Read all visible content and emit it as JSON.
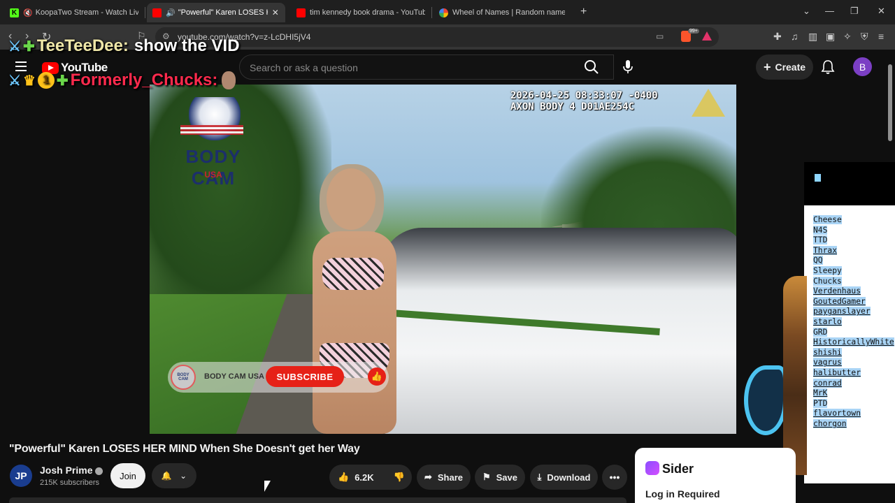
{
  "browser": {
    "tabs": [
      {
        "label": "KoopaTwo Stream - Watch Live o",
        "favicon_color": "#53fc18",
        "favicon_letter": "K"
      },
      {
        "label": "\"Powerful\" Karen LOSES HER I",
        "favicon_color": "#ff0000",
        "active": true
      },
      {
        "label": "tim kennedy book drama - YouTube",
        "favicon_color": "#ff0000"
      },
      {
        "label": "Wheel of Names | Random name pic",
        "favicon_color": "#4285f4"
      }
    ],
    "close_symbol": "✕",
    "new_tab_symbol": "+",
    "url": "youtube.com/watch?v=z-LcDHI5jV4",
    "extension_badge": "99+"
  },
  "youtube": {
    "logo_text": "YouTube",
    "search_placeholder": "Search or ask a question",
    "create_label": "Create",
    "account_initial": "B",
    "video": {
      "osd_timestamp": "2026-04-25 08:33:07 -0400",
      "osd_device": "AXON BODY 4 D01AE254C",
      "watermark_text": "BODY CAM",
      "watermark_sub": "USA",
      "overlay_badge": "BODY CAM",
      "overlay_channel": "BODY CAM USA",
      "overlay_subscribe": "SUBSCRIBE"
    },
    "title": "\"Powerful\" Karen LOSES HER MIND When She Doesn't get her Way",
    "channel": {
      "initials": "JP",
      "name": "Josh Prime",
      "subscribers": "215K subscribers"
    },
    "actions": {
      "join": "Join",
      "likes": "6.2K",
      "share": "Share",
      "save": "Save",
      "download": "Download",
      "more": "•••"
    }
  },
  "stream_chat": [
    {
      "user": "TeeTeeDee:",
      "message": "show the VID",
      "user_color": "#efe7a8"
    },
    {
      "user": "Formerly_Chucks:",
      "message": "",
      "user_color": "#ff2a4d",
      "badge_number": "1"
    }
  ],
  "name_list": [
    {
      "name": "Cheese",
      "underlined": false
    },
    {
      "name": "N4S",
      "underlined": false
    },
    {
      "name": "TTD",
      "underlined": false
    },
    {
      "name": "Thrax",
      "underlined": true
    },
    {
      "name": "QQ",
      "underlined": false
    },
    {
      "name": "Sleepy",
      "underlined": false
    },
    {
      "name": "Chucks",
      "underlined": false
    },
    {
      "name": "Verdenhaus",
      "underlined": true
    },
    {
      "name": "GoutedGamer",
      "underlined": true
    },
    {
      "name": "payganslayer",
      "underlined": true
    },
    {
      "name": "starlo",
      "underlined": true
    },
    {
      "name": "GRD",
      "underlined": false
    },
    {
      "name": "HistoricallyWhite",
      "underlined": true
    },
    {
      "name": "shishi",
      "underlined": true
    },
    {
      "name": "vagrus",
      "underlined": true
    },
    {
      "name": "halibutter",
      "underlined": true
    },
    {
      "name": "conrad",
      "underlined": true
    },
    {
      "name": "MrK",
      "underlined": true
    },
    {
      "name": "PTD",
      "underlined": false
    },
    {
      "name": "flavortown",
      "underlined": true
    },
    {
      "name": "chorgon",
      "underlined": true
    }
  ],
  "sider": {
    "title": "Sider",
    "status": "Log in Required"
  },
  "colors": {
    "youtube_red": "#ff0000",
    "background": "#0f0f0f",
    "pill": "#272727",
    "highlight": "#a9d4f5"
  }
}
